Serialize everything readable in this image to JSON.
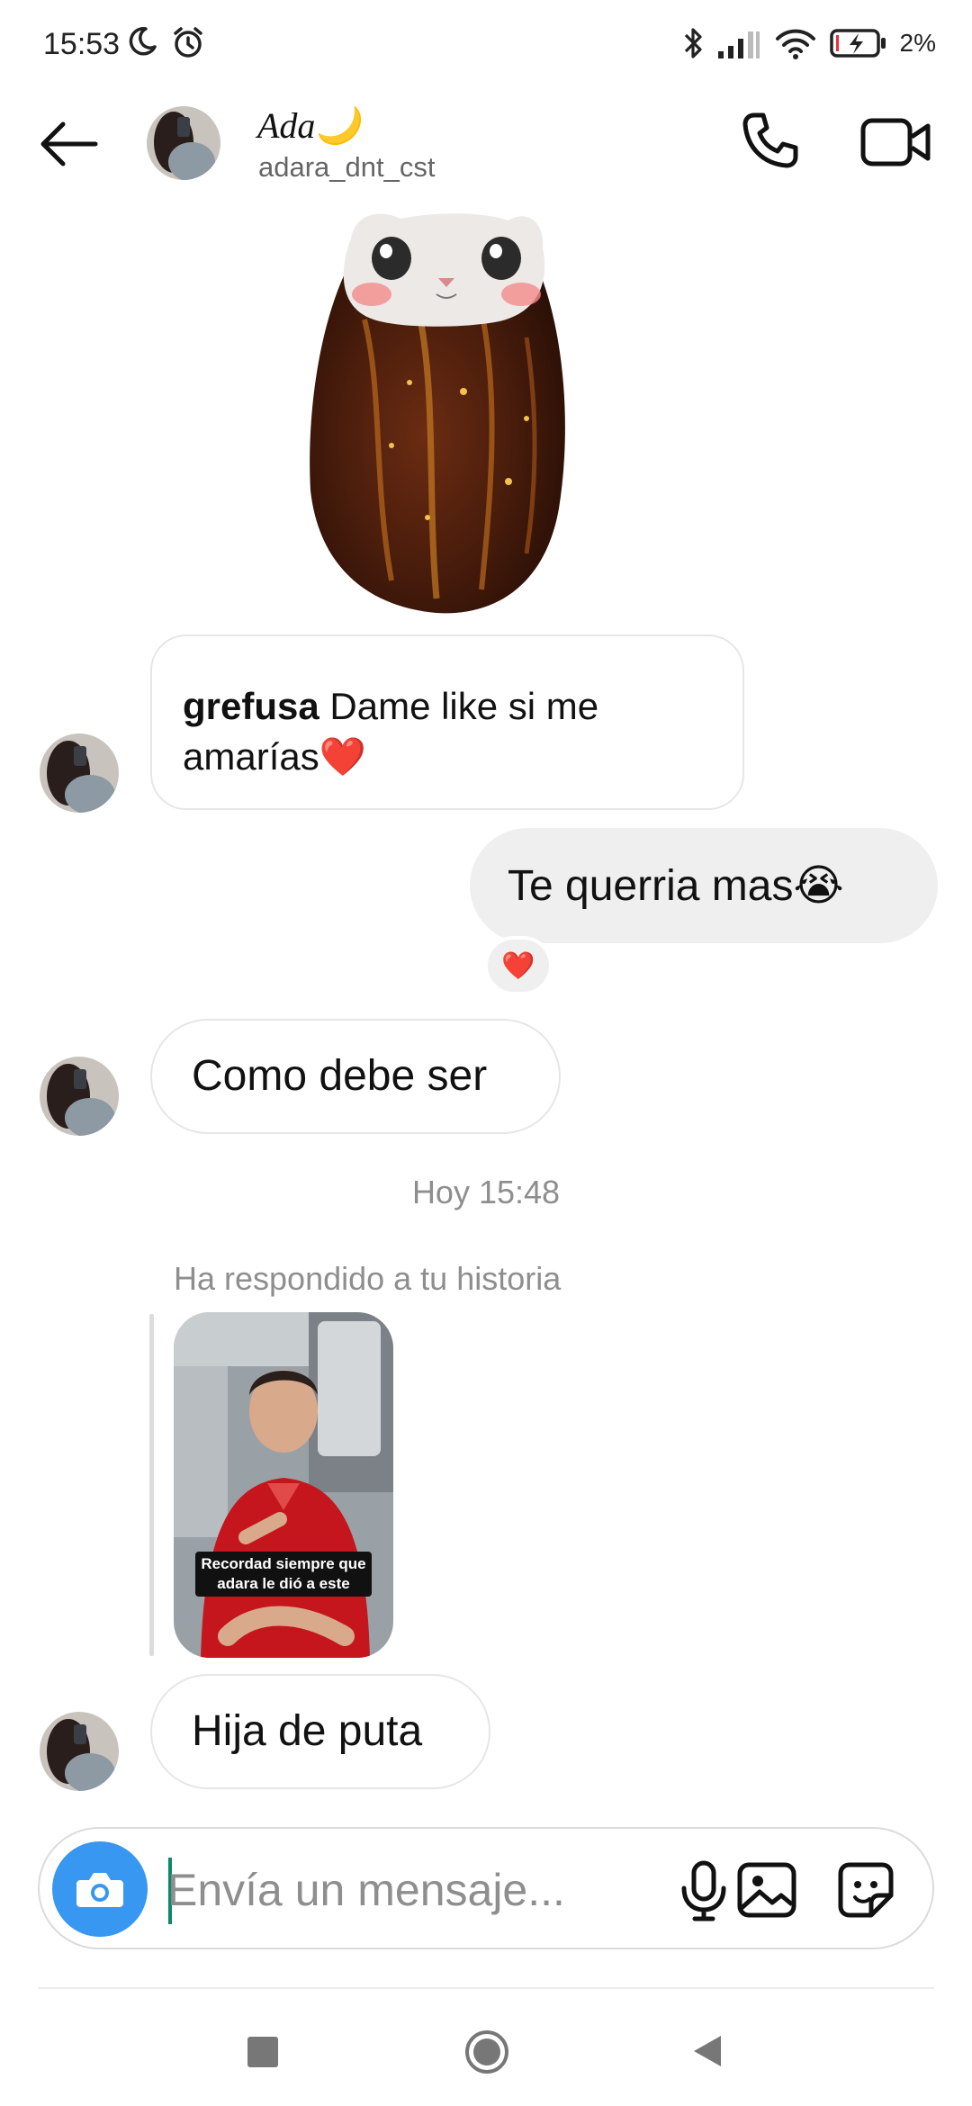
{
  "status_bar": {
    "time": "15:53",
    "battery_percent": "2%",
    "icons": [
      "moon-icon",
      "alarm-icon",
      "bluetooth-icon",
      "signal-icon",
      "wifi-icon",
      "battery-charging-icon"
    ]
  },
  "header": {
    "display_name": "Ada🌙",
    "username": "adara_dnt_cst",
    "icons": [
      "back-arrow-icon",
      "phone-icon",
      "video-camera-icon"
    ]
  },
  "messages": {
    "shared_post": {
      "username": "grefusa",
      "caption": "Dame like si me amarías❤️"
    },
    "outgoing_1": "Te querria mas😭",
    "reaction": "❤️",
    "incoming_1": "Como debe ser",
    "timestamp": "Hoy 15:48",
    "story_reply_note": "Ha respondido a tu historia",
    "story_caption": "Recordad siempre que adara le dió a este",
    "incoming_2": "Hija de puta"
  },
  "composer": {
    "placeholder": "Envía un mensaje...",
    "icons": [
      "camera-icon",
      "microphone-icon",
      "gallery-icon",
      "sticker-icon"
    ]
  },
  "nav_bar": {
    "icons": [
      "recents-icon",
      "home-icon",
      "back-icon"
    ]
  },
  "colors": {
    "accent": "#3897f0",
    "bubble_out": "#efefef",
    "muted_text": "#8e8e8e",
    "heart": "#e8303a"
  }
}
